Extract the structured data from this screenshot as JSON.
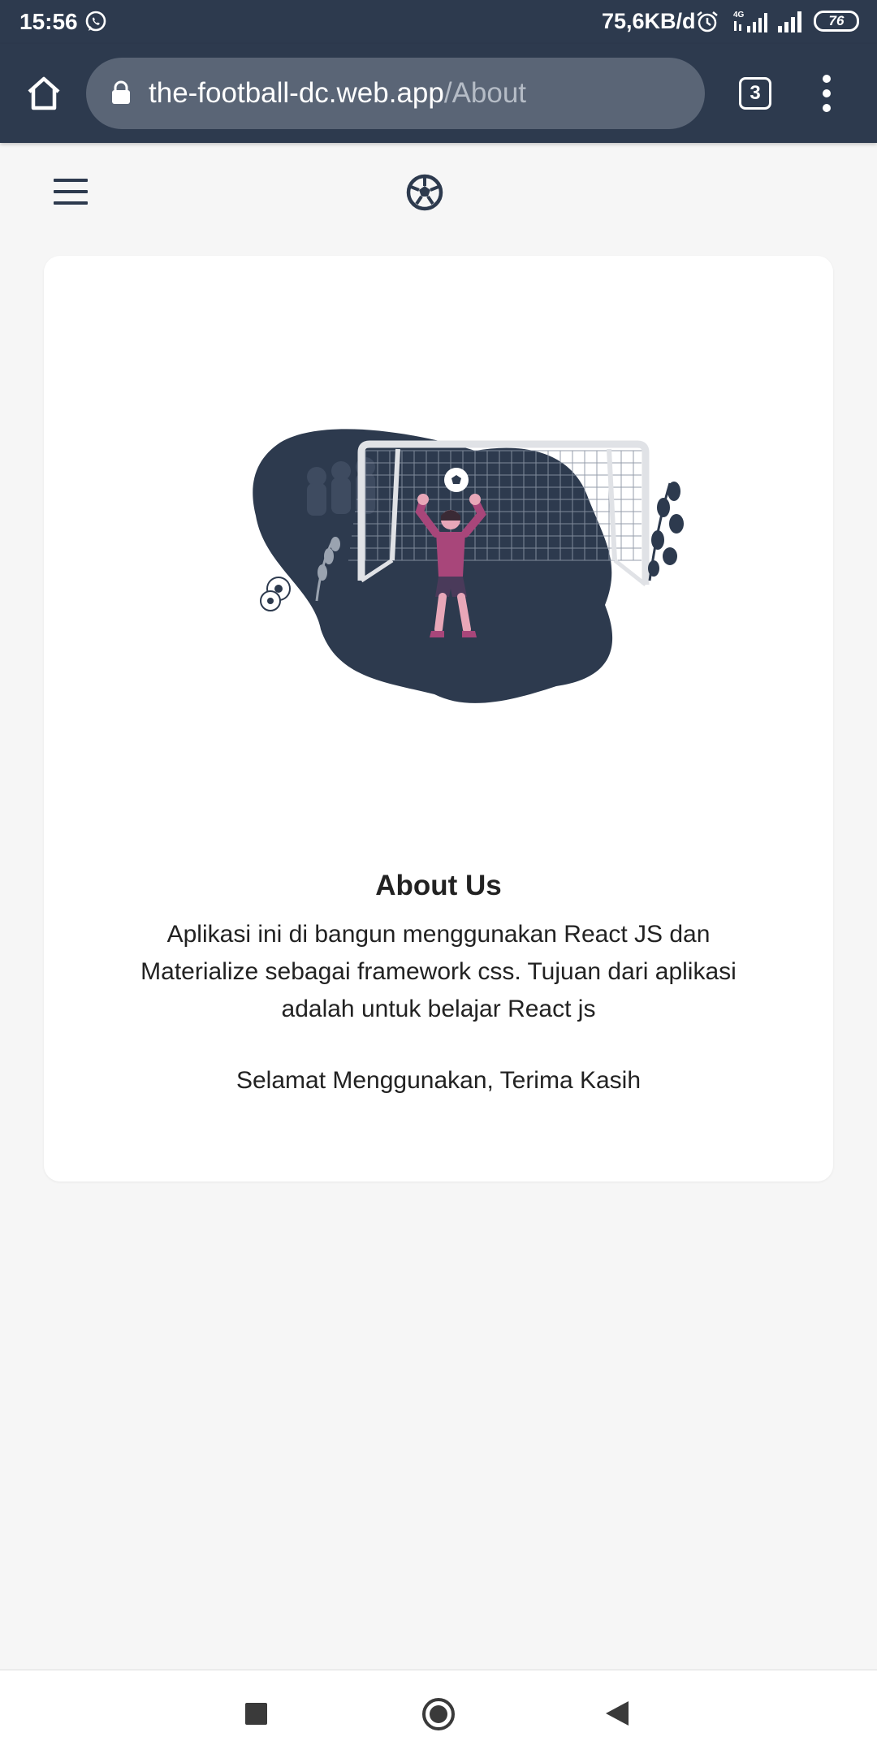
{
  "status_bar": {
    "time": "15:56",
    "network_speed": "75,6KB/d",
    "battery": "76",
    "network_type": "4G",
    "icons": [
      "whatsapp-icon",
      "alarm-icon",
      "signal-4g-icon",
      "signal-icon",
      "battery-icon"
    ]
  },
  "browser": {
    "url_domain": "the-football-dc.web.app",
    "url_path": "/About",
    "tab_count": "3",
    "icons": [
      "home-icon",
      "lock-icon",
      "tabs-icon",
      "more-vert-icon"
    ]
  },
  "app_header": {
    "icons": [
      "hamburger-menu-icon",
      "soccer-ball-icon"
    ]
  },
  "about": {
    "title": "About Us",
    "body": "Aplikasi ini di bangun menggunakan React JS dan Materialize sebagai framework css. Tujuan dari aplikasi adalah untuk belajar React js",
    "thanks": "Selamat Menggunakan, Terima Kasih"
  },
  "colors": {
    "header_bg": "#2d3a4e",
    "urlbar_bg": "#5a6576",
    "page_bg": "#f6f6f6",
    "card_bg": "#ffffff",
    "illustration_dark": "#2d3a4e",
    "illustration_accent": "#a8467a"
  },
  "nav_bar": {
    "icons": [
      "recent-apps-icon",
      "home-circle-icon",
      "back-icon"
    ]
  }
}
